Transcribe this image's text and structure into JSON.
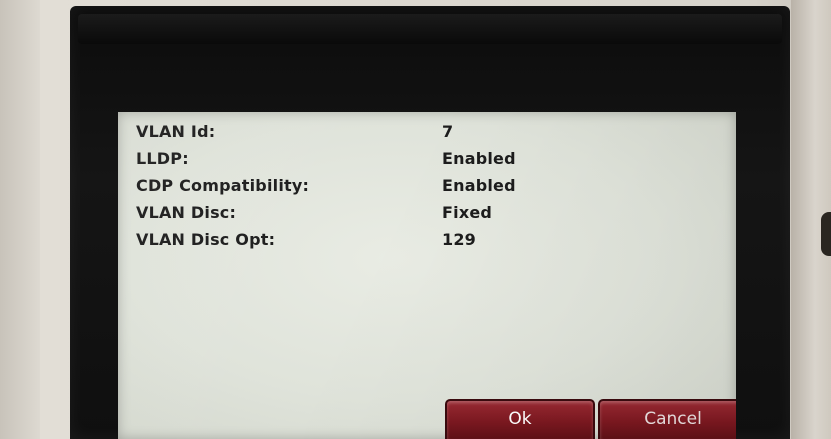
{
  "settings": {
    "rows": [
      {
        "label": "VLAN Id:",
        "value": "7"
      },
      {
        "label": "LLDP:",
        "value": "Enabled"
      },
      {
        "label": "CDP Compatibility:",
        "value": "Enabled"
      },
      {
        "label": "VLAN Disc:",
        "value": "Fixed"
      },
      {
        "label": "VLAN Disc Opt:",
        "value": "129"
      }
    ]
  },
  "softkeys": {
    "ok": "Ok",
    "cancel": "Cancel"
  },
  "colors": {
    "softkey": "#7c1820",
    "screen_background": "#e2e6dc",
    "bezel": "#111111"
  }
}
